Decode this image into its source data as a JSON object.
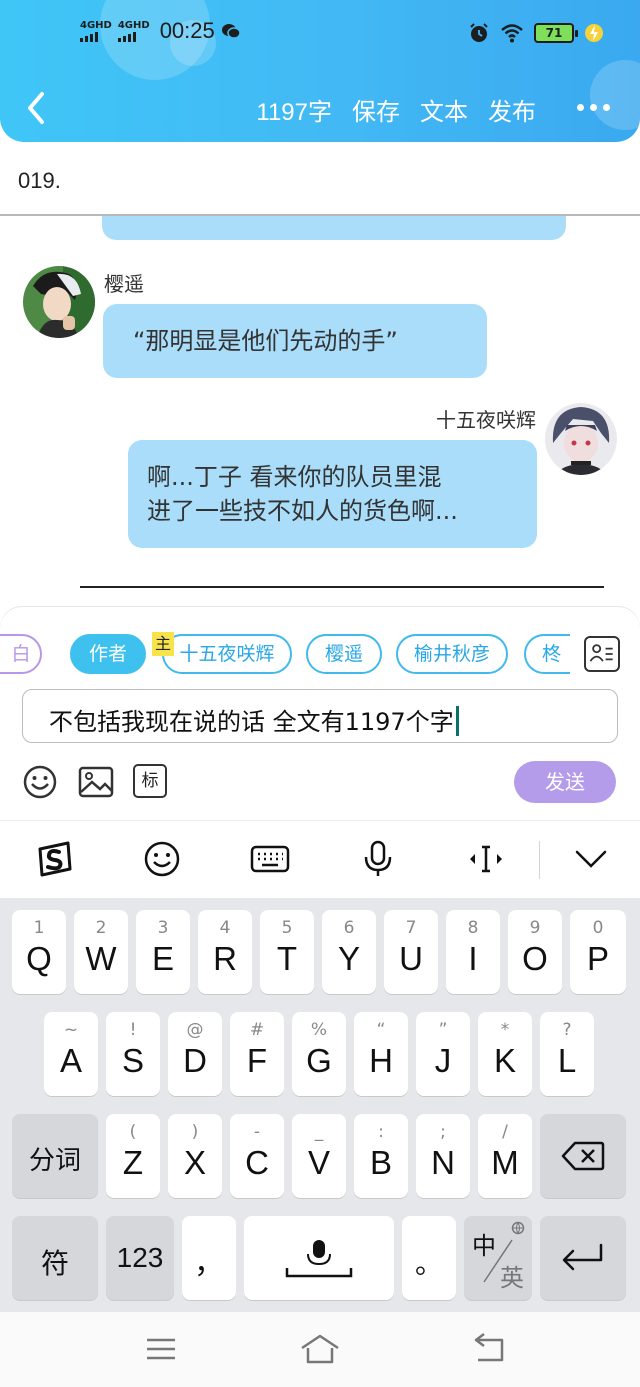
{
  "status_bar": {
    "network_1": "4GHD",
    "network_2": "4GHD",
    "time": "00:25",
    "battery": "71"
  },
  "header": {
    "word_count": "1197字",
    "save_label": "保存",
    "text_label": "文本",
    "publish_label": "发布"
  },
  "chapter": {
    "title": "019."
  },
  "messages": [
    {
      "speaker": "樱遥",
      "text": "“那明显是他们先动的手”"
    },
    {
      "speaker": "十五夜咲辉",
      "line1": "啊...丁子 看来你的队员里混",
      "line2": "进了一些技不如人的货色啊..."
    }
  ],
  "composer": {
    "chips": [
      "白",
      "作者",
      "十五夜咲辉",
      "樱遥",
      "榆井秋彦",
      "柊"
    ],
    "owner_tag": "主",
    "input_value": "不包括我现在说的话 全文有1197个字",
    "tag_button": "标",
    "send_label": "发送"
  },
  "keyboard": {
    "row1": [
      {
        "main": "Q",
        "sub": "1"
      },
      {
        "main": "W",
        "sub": "2"
      },
      {
        "main": "E",
        "sub": "3"
      },
      {
        "main": "R",
        "sub": "4"
      },
      {
        "main": "T",
        "sub": "5"
      },
      {
        "main": "Y",
        "sub": "6"
      },
      {
        "main": "U",
        "sub": "7"
      },
      {
        "main": "I",
        "sub": "8"
      },
      {
        "main": "O",
        "sub": "9"
      },
      {
        "main": "P",
        "sub": "0"
      }
    ],
    "row2": [
      {
        "main": "A",
        "sub": "~"
      },
      {
        "main": "S",
        "sub": "!"
      },
      {
        "main": "D",
        "sub": "@"
      },
      {
        "main": "F",
        "sub": "#"
      },
      {
        "main": "G",
        "sub": "%"
      },
      {
        "main": "H",
        "sub": "“"
      },
      {
        "main": "J",
        "sub": "”"
      },
      {
        "main": "K",
        "sub": "*"
      },
      {
        "main": "L",
        "sub": "?"
      }
    ],
    "row3": [
      {
        "main": "Z",
        "sub": "("
      },
      {
        "main": "X",
        "sub": ")"
      },
      {
        "main": "C",
        "sub": "-"
      },
      {
        "main": "V",
        "sub": "_"
      },
      {
        "main": "B",
        "sub": ":"
      },
      {
        "main": "N",
        "sub": ";"
      },
      {
        "main": "M",
        "sub": "/"
      }
    ],
    "fenci": "分词",
    "symbols": "符",
    "numbers": "123",
    "comma": "，",
    "period": "。",
    "lang_zh": "中",
    "lang_en": "英"
  },
  "colors": {
    "header_blue": "#42b8f4",
    "bubble_blue": "#a9ddf9",
    "send_purple": "#b59ceb",
    "chip_blue": "#40b9ef"
  }
}
